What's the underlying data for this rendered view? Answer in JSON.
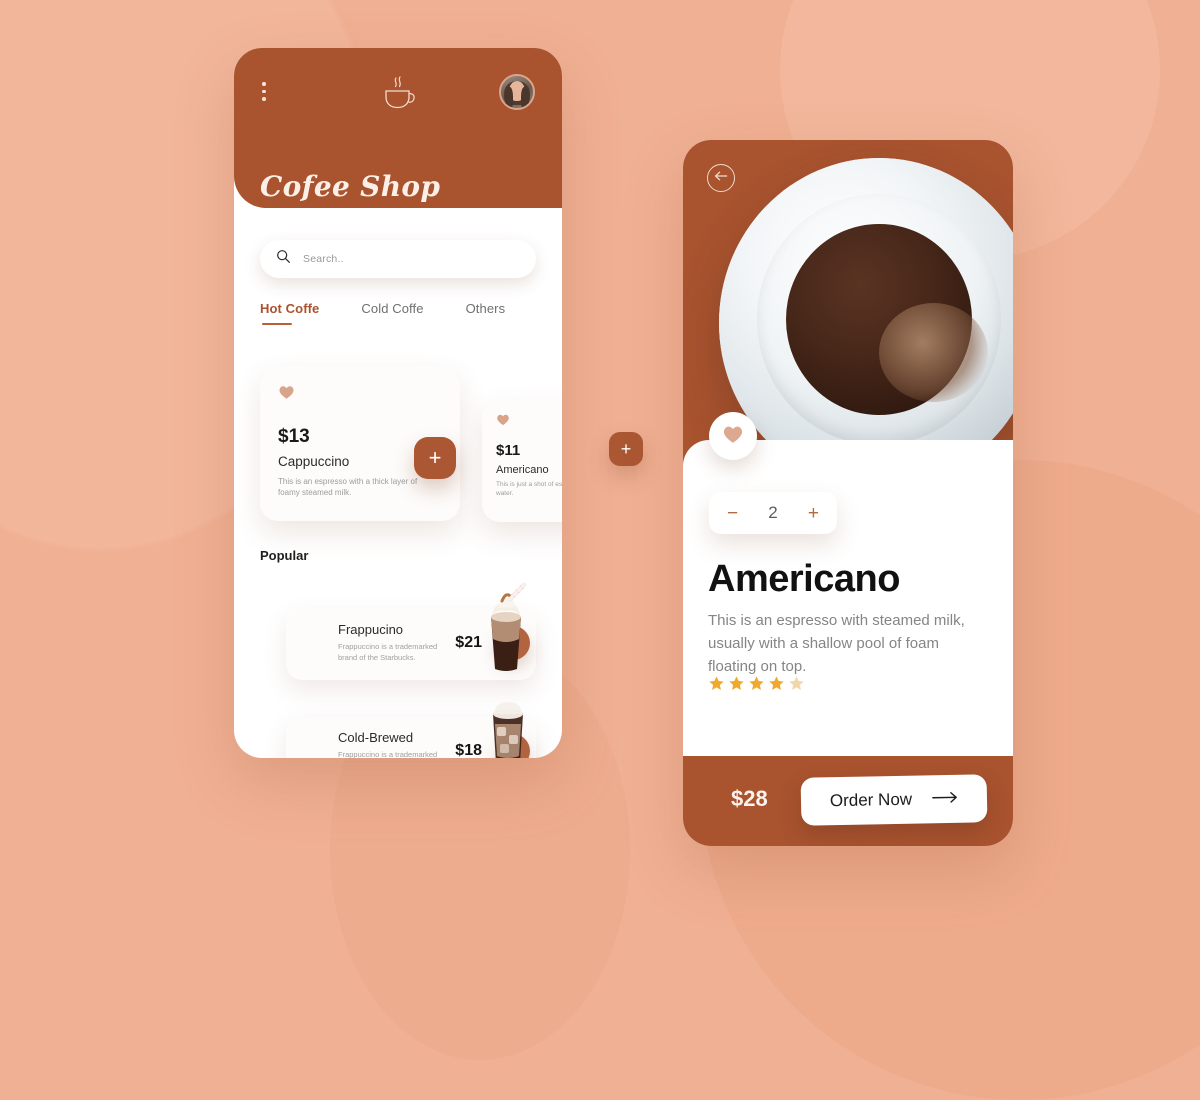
{
  "theme": {
    "background": "#f0b093",
    "brand_brown": "#a9532f",
    "accent_button": "#ab5733",
    "card_white": "#fdfcfb",
    "star_gold": "#f0a92c",
    "heart_pink": "#d9a48c"
  },
  "left_screen": {
    "icons": {
      "menu": "kebab-menu-icon",
      "logo": "coffee-cup-icon",
      "avatar": "user-avatar"
    },
    "title": "Cofee Shop",
    "search": {
      "placeholder": "Search..",
      "icon": "search-icon"
    },
    "tabs": [
      {
        "label": "Hot Coffe",
        "active": true
      },
      {
        "label": "Cold Coffe",
        "active": false
      },
      {
        "label": "Others",
        "active": false
      }
    ],
    "products": [
      {
        "price": "$13",
        "name": "Cappuccino",
        "desc": "This is an espresso with a thick layer of foamy steamed milk.",
        "add_label": "+",
        "favorite_icon": "heart-icon"
      },
      {
        "price": "$11",
        "name": "Americano",
        "desc": "This is just a shot of espresso with hot water.",
        "add_label": "+",
        "favorite_icon": "heart-icon"
      }
    ],
    "popular": {
      "heading": "Popular",
      "items": [
        {
          "name": "Frappucino",
          "desc": "Frappuccino is a trademarked brand of the Starbucks.",
          "price": "$21",
          "add_label": "+"
        },
        {
          "name": "Cold-Brewed",
          "desc": "Frappuccino is a trademarked brand of the Starbucks.",
          "price": "$18",
          "add_label": "+"
        }
      ]
    }
  },
  "right_screen": {
    "back_icon": "arrow-left-icon",
    "favorite_icon": "heart-icon",
    "quantity": {
      "minus_label": "−",
      "value": "2",
      "plus_label": "+"
    },
    "product_name": "Americano",
    "product_desc": "This is an espresso with steamed milk, usually with a shallow pool of foam floating on top.",
    "rating": {
      "filled": 4,
      "total": 5
    },
    "total_price": "$28",
    "order_button": {
      "label": "Order Now",
      "icon": "arrow-right-icon"
    }
  }
}
